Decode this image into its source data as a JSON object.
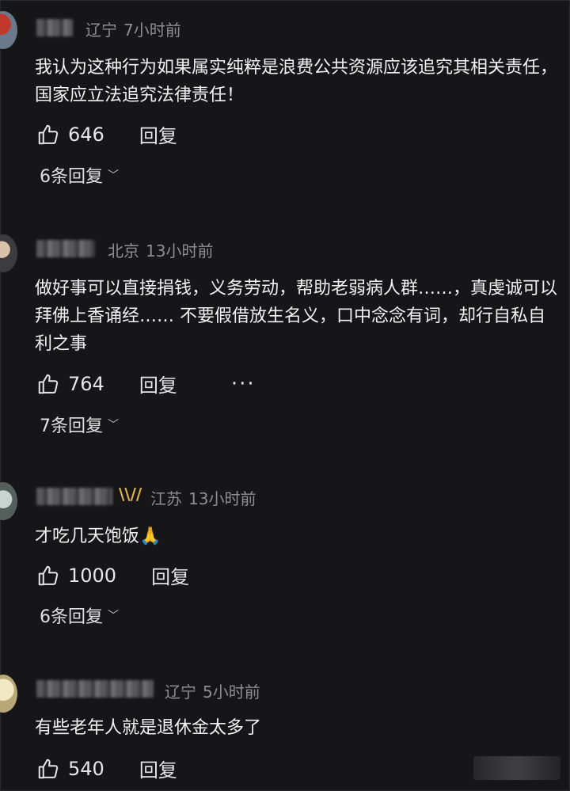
{
  "comments": [
    {
      "location": "辽宁",
      "time": "7小时前",
      "text": "我认为这种行为如果属实纯粹是浪费公共资源应该追究其相关责任，国家应立法追究法律责任！",
      "likes": "646",
      "reply_label": "回复",
      "replies_label": "6条回复"
    },
    {
      "location": "北京",
      "time": "13小时前",
      "text": "做好事可以直接捐钱，义务劳动，帮助老弱病人群……，真虔诚可以拜佛上香诵经…… 不要假借放生名义，口中念念有词，却行自私自利之事",
      "likes": "764",
      "reply_label": "回复",
      "more_label": "···",
      "replies_label": "7条回复"
    },
    {
      "location": "江苏",
      "time": "13小时前",
      "text": "才吃几天饱饭🙏",
      "likes": "1000",
      "reply_label": "回复",
      "replies_label": "6条回复"
    },
    {
      "location": "辽宁",
      "time": "5小时前",
      "text": "有些老年人就是退休金太多了",
      "likes": "540",
      "reply_label": "回复"
    }
  ],
  "icons": {
    "like": "thumbs-up-icon",
    "chevron": "chevron-down-icon",
    "vip": "vip-badge-icon"
  },
  "chevron_glyph": "﹀",
  "vip_glyph": "\\\\//"
}
